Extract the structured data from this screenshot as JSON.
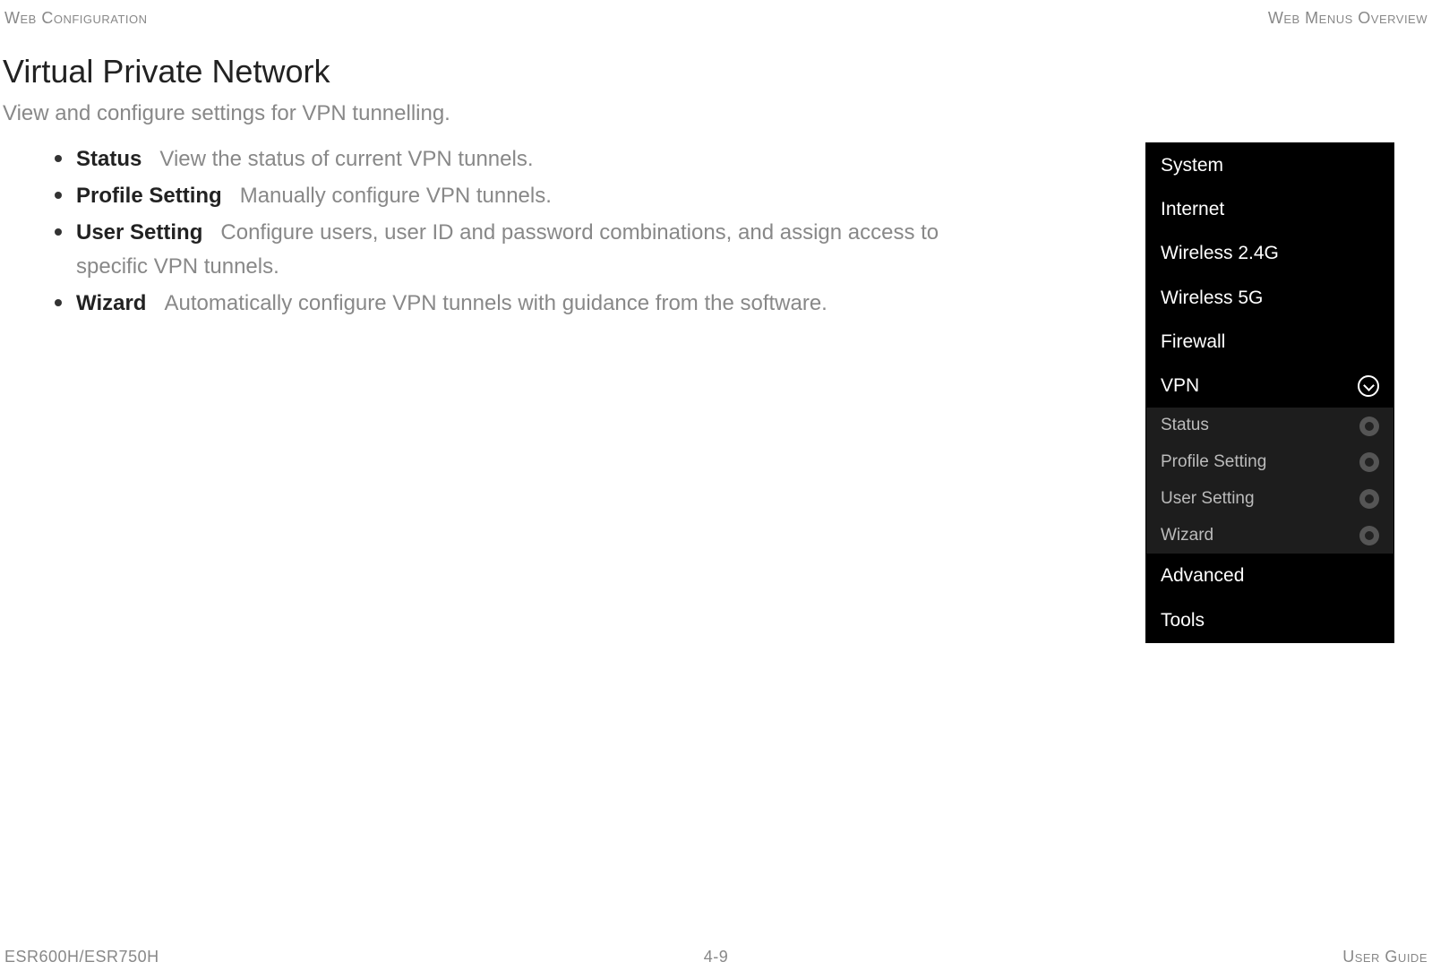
{
  "header": {
    "left": "Web Configuration",
    "right": "Web Menus Overview"
  },
  "page": {
    "title": "Virtual Private Network",
    "subtitle": "View and configure settings for VPN tunnelling."
  },
  "items": [
    {
      "label": "Status",
      "desc": "View the status of current VPN tunnels."
    },
    {
      "label": "Profile Setting",
      "desc": "Manually configure VPN tunnels."
    },
    {
      "label": "User Setting",
      "desc": "Configure users, user ID and password combinations, and assign access to specific VPN tunnels."
    },
    {
      "label": "Wizard",
      "desc": "Automatically configure VPN tunnels with guidance from the software."
    }
  ],
  "sidebar": {
    "top": [
      "System",
      "Internet",
      "Wireless 2.4G",
      "Wireless 5G",
      "Firewall"
    ],
    "expanded": "VPN",
    "sub": [
      "Status",
      "Profile Setting",
      "User Setting",
      "Wizard"
    ],
    "bottom": [
      "Advanced",
      "Tools"
    ]
  },
  "footer": {
    "left": "ESR600H/ESR750H",
    "center": "4-9",
    "right": "User Guide"
  }
}
